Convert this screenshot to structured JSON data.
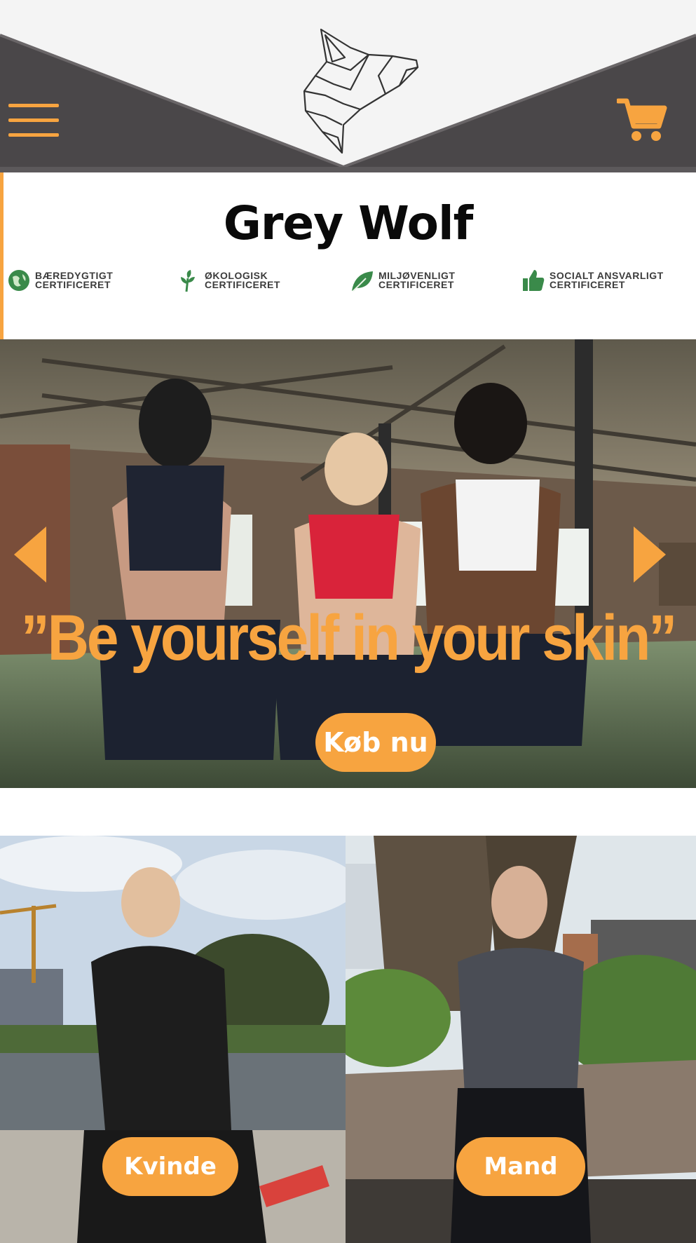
{
  "header": {
    "menu_icon": "hamburger-menu-icon",
    "cart_icon": "shopping-cart-icon",
    "logo_icon": "wolf-head-logo",
    "colors": {
      "bar": "#4a4749",
      "accent": "#f7a440",
      "background": "#f4f4f4"
    }
  },
  "brand": {
    "title": "Grey Wolf"
  },
  "certifications": [
    {
      "icon": "globe-icon",
      "line1": "BÆREDYGTIGT",
      "line2": "CERTIFICERET"
    },
    {
      "icon": "plant-sprout-icon",
      "line1": "ØKOLOGISK",
      "line2": "CERTIFICERET"
    },
    {
      "icon": "leaf-icon",
      "line1": "MILJØVENLIGT",
      "line2": "CERTIFICERET"
    },
    {
      "icon": "thumbs-up-icon",
      "line1": "SOCIALT ANSVARLIGT",
      "line2": "CERTIFICERET"
    }
  ],
  "hero": {
    "quote": "”Be yourself in your skin”",
    "cta_label": "Køb nu",
    "prev_icon": "chevron-left-icon",
    "next_icon": "chevron-right-icon"
  },
  "categories": [
    {
      "label": "Kvinde"
    },
    {
      "label": "Mand"
    }
  ]
}
